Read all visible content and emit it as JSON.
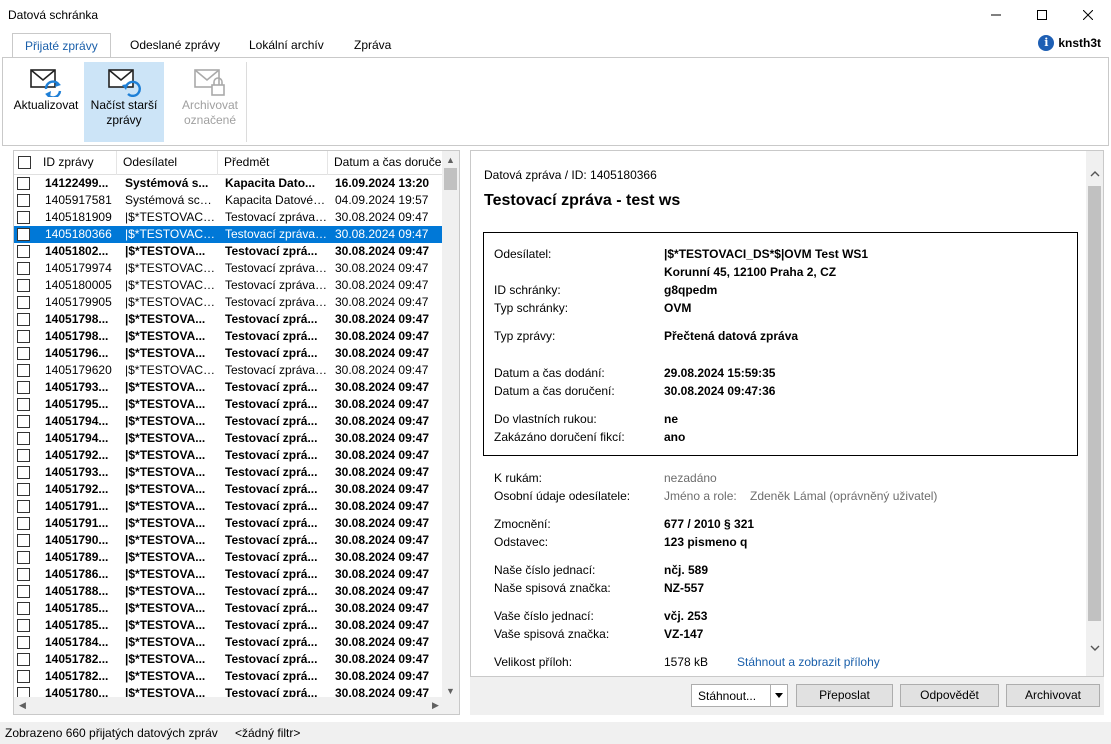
{
  "window": {
    "title": "Datová schránka"
  },
  "tabs": [
    {
      "label": "Přijaté zprávy",
      "active": true
    },
    {
      "label": "Odeslané zprávy",
      "active": false
    },
    {
      "label": "Lokální archív",
      "active": false
    },
    {
      "label": "Zpráva",
      "active": false
    }
  ],
  "user": {
    "name": "knsth3t",
    "icon": "info-icon"
  },
  "ribbon": [
    {
      "label": "Aktualizovat",
      "icon": "mail-refresh-icon",
      "state": "normal"
    },
    {
      "label": "Načíst starší zprávy",
      "icon": "mail-load-older-icon",
      "state": "selected"
    },
    {
      "label": "Archivovat označené",
      "icon": "mail-archive-icon",
      "state": "disabled"
    }
  ],
  "list": {
    "columns": [
      "ID zprávy",
      "Odesílatel",
      "Předmět",
      "Datum a čas doručení"
    ],
    "rows": [
      {
        "id": "14122499...",
        "sender": "Systémová s...",
        "subject": "Kapacita Dato...",
        "date": "16.09.2024 13:20",
        "bold": true
      },
      {
        "id": "1405917581",
        "sender": "Systémová schr...",
        "subject": "Kapacita Datovéh...",
        "date": "04.09.2024 19:57",
        "bold": false
      },
      {
        "id": "1405181909",
        "sender": "|$*TESTOVACI_...",
        "subject": "Testovací zpráva ...",
        "date": "30.08.2024 09:47",
        "bold": false
      },
      {
        "id": "1405180366",
        "sender": "|$*TESTOVACI_...",
        "subject": "Testovací zpráva ...",
        "date": "30.08.2024 09:47",
        "bold": false,
        "selected": true
      },
      {
        "id": "14051802...",
        "sender": "|$*TESTOVA...",
        "subject": "Testovací zprá...",
        "date": "30.08.2024 09:47",
        "bold": true
      },
      {
        "id": "1405179974",
        "sender": "|$*TESTOVACI_...",
        "subject": "Testovací zpráva ...",
        "date": "30.08.2024 09:47",
        "bold": false
      },
      {
        "id": "1405180005",
        "sender": "|$*TESTOVACI_...",
        "subject": "Testovací zpráva ...",
        "date": "30.08.2024 09:47",
        "bold": false
      },
      {
        "id": "1405179905",
        "sender": "|$*TESTOVACI_...",
        "subject": "Testovací zpráva ...",
        "date": "30.08.2024 09:47",
        "bold": false
      },
      {
        "id": "14051798...",
        "sender": "|$*TESTOVA...",
        "subject": "Testovací zprá...",
        "date": "30.08.2024 09:47",
        "bold": true
      },
      {
        "id": "14051798...",
        "sender": "|$*TESTOVA...",
        "subject": "Testovací zprá...",
        "date": "30.08.2024 09:47",
        "bold": true
      },
      {
        "id": "14051796...",
        "sender": "|$*TESTOVA...",
        "subject": "Testovací zprá...",
        "date": "30.08.2024 09:47",
        "bold": true
      },
      {
        "id": "1405179620",
        "sender": "|$*TESTOVACI_...",
        "subject": "Testovací zpráva ...",
        "date": "30.08.2024 09:47",
        "bold": false
      },
      {
        "id": "14051793...",
        "sender": "|$*TESTOVA...",
        "subject": "Testovací zprá...",
        "date": "30.08.2024 09:47",
        "bold": true
      },
      {
        "id": "14051795...",
        "sender": "|$*TESTOVA...",
        "subject": "Testovací zprá...",
        "date": "30.08.2024 09:47",
        "bold": true
      },
      {
        "id": "14051794...",
        "sender": "|$*TESTOVA...",
        "subject": "Testovací zprá...",
        "date": "30.08.2024 09:47",
        "bold": true
      },
      {
        "id": "14051794...",
        "sender": "|$*TESTOVA...",
        "subject": "Testovací zprá...",
        "date": "30.08.2024 09:47",
        "bold": true
      },
      {
        "id": "14051792...",
        "sender": "|$*TESTOVA...",
        "subject": "Testovací zprá...",
        "date": "30.08.2024 09:47",
        "bold": true
      },
      {
        "id": "14051793...",
        "sender": "|$*TESTOVA...",
        "subject": "Testovací zprá...",
        "date": "30.08.2024 09:47",
        "bold": true
      },
      {
        "id": "14051792...",
        "sender": "|$*TESTOVA...",
        "subject": "Testovací zprá...",
        "date": "30.08.2024 09:47",
        "bold": true
      },
      {
        "id": "14051791...",
        "sender": "|$*TESTOVA...",
        "subject": "Testovací zprá...",
        "date": "30.08.2024 09:47",
        "bold": true
      },
      {
        "id": "14051791...",
        "sender": "|$*TESTOVA...",
        "subject": "Testovací zprá...",
        "date": "30.08.2024 09:47",
        "bold": true
      },
      {
        "id": "14051790...",
        "sender": "|$*TESTOVA...",
        "subject": "Testovací zprá...",
        "date": "30.08.2024 09:47",
        "bold": true
      },
      {
        "id": "14051789...",
        "sender": "|$*TESTOVA...",
        "subject": "Testovací zprá...",
        "date": "30.08.2024 09:47",
        "bold": true
      },
      {
        "id": "14051786...",
        "sender": "|$*TESTOVA...",
        "subject": "Testovací zprá...",
        "date": "30.08.2024 09:47",
        "bold": true
      },
      {
        "id": "14051788...",
        "sender": "|$*TESTOVA...",
        "subject": "Testovací zprá...",
        "date": "30.08.2024 09:47",
        "bold": true
      },
      {
        "id": "14051785...",
        "sender": "|$*TESTOVA...",
        "subject": "Testovací zprá...",
        "date": "30.08.2024 09:47",
        "bold": true
      },
      {
        "id": "14051785...",
        "sender": "|$*TESTOVA...",
        "subject": "Testovací zprá...",
        "date": "30.08.2024 09:47",
        "bold": true
      },
      {
        "id": "14051784...",
        "sender": "|$*TESTOVA...",
        "subject": "Testovací zprá...",
        "date": "30.08.2024 09:47",
        "bold": true
      },
      {
        "id": "14051782...",
        "sender": "|$*TESTOVA...",
        "subject": "Testovací zprá...",
        "date": "30.08.2024 09:47",
        "bold": true
      },
      {
        "id": "14051782...",
        "sender": "|$*TESTOVA...",
        "subject": "Testovací zprá...",
        "date": "30.08.2024 09:47",
        "bold": true
      },
      {
        "id": "14051780...",
        "sender": "|$*TESTOVA...",
        "subject": "Testovací zprá...",
        "date": "30.08.2024 09:47",
        "bold": true
      }
    ]
  },
  "detail": {
    "subtitle": "Datová zpráva / ID: 1405180366",
    "title": "Testovací zpráva - test ws",
    "sender_label": "Odesílatel:",
    "sender_name": "|$*TESTOVACI_DS*$|OVM Test WS1",
    "sender_address": "Korunní 45, 12100 Praha 2, CZ",
    "box_id_label": "ID schránky:",
    "box_id": "g8qpedm",
    "box_type_label": "Typ schránky:",
    "box_type": "OVM",
    "msg_type_label": "Typ zprávy:",
    "msg_type": "Přečtená datová zpráva",
    "delivered_label": "Datum a čas dodání:",
    "delivered": "29.08.2024 15:59:35",
    "received_label": "Datum a čas doručení:",
    "received": "30.08.2024 09:47:36",
    "personal_label": "Do vlastních rukou:",
    "personal": "ne",
    "fiction_label": "Zakázáno doručení fikcí:",
    "fiction": "ano",
    "to_hands_label": "K rukám:",
    "to_hands": "nezadáno",
    "sender_person_label": "Osobní údaje odesílatele:",
    "sender_person_role_label": "Jméno a role:",
    "sender_person": "Zdeněk Lámal (oprávněný uživatel)",
    "auth_label": "Zmocnění:",
    "auth": "677 / 2010 § 321",
    "paragraph_label": "Odstavec:",
    "paragraph": "123 pismeno q",
    "our_ref_label": "Naše číslo jednací:",
    "our_ref": "nčj. 589",
    "our_file_label": "Naše spisová značka:",
    "our_file": "NZ-557",
    "your_ref_label": "Vaše číslo jednací:",
    "your_ref": "včj. 253",
    "your_file_label": "Vaše spisová značka:",
    "your_file": "VZ-147",
    "size_label": "Velikost příloh:",
    "size": "1578 kB",
    "attachments_link": "Stáhnout a zobrazit přílohy"
  },
  "actions": {
    "download": "Stáhnout...",
    "forward": "Přeposlat",
    "reply": "Odpovědět",
    "archive": "Archivovat"
  },
  "status": {
    "count_text": "Zobrazeno 660 přijatých datových zpráv",
    "filter_text": "<žádný filtr>"
  },
  "colors": {
    "selection": "#0078d7",
    "ribbon_selected": "#cce4f7",
    "link": "#1a5faa",
    "info_icon": "#1e5fb4"
  }
}
